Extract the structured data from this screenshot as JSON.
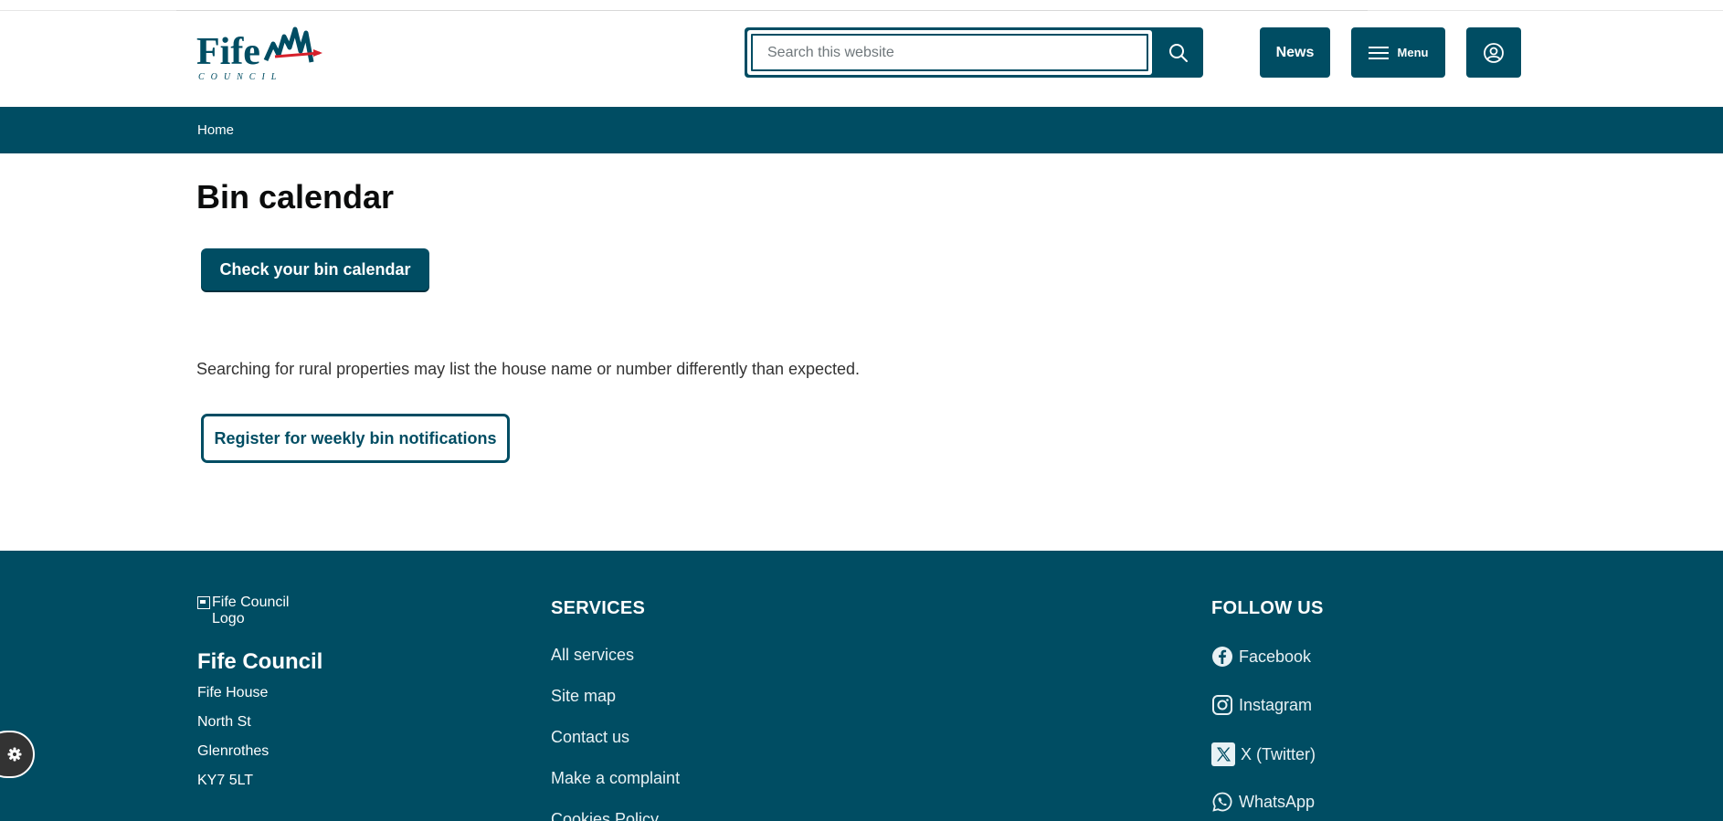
{
  "header": {
    "logo_text": "Fife",
    "logo_sub": "COUNCIL",
    "search_placeholder": "Search this website",
    "news_label": "News",
    "menu_label": "Menu",
    "icons": {
      "search": "search-icon",
      "menu": "hamburger-icon",
      "account": "user-icon"
    }
  },
  "breadcrumb": {
    "items": [
      {
        "label": "Home"
      }
    ]
  },
  "main": {
    "title": "Bin calendar",
    "primary_button": "Check your bin calendar",
    "info_text": "Searching for rural properties may list the house name or number differently than expected.",
    "secondary_button": "Register for weekly bin notifications"
  },
  "footer": {
    "logo_alt": "Fife Council Logo",
    "org_name": "Fife Council",
    "address": [
      "Fife House",
      "North St",
      "Glenrothes",
      "KY7 5LT"
    ],
    "services_heading": "SERVICES",
    "services_links": [
      "All services",
      "Site map",
      "Contact us",
      "Make a complaint",
      "Cookies Policy"
    ],
    "follow_heading": "FOLLOW US",
    "social_links": [
      {
        "label": "Facebook",
        "icon": "facebook-icon"
      },
      {
        "label": "Instagram",
        "icon": "instagram-icon"
      },
      {
        "label": "X (Twitter)",
        "icon": "x-twitter-icon"
      },
      {
        "label": "WhatsApp",
        "icon": "whatsapp-icon"
      }
    ]
  },
  "cookie_settings": {
    "icon": "gear-icon"
  },
  "colors": {
    "brand": "#004d63",
    "logo_red": "#d6202b",
    "text": "#0b0c0c",
    "cookie_fab": "#333333"
  }
}
